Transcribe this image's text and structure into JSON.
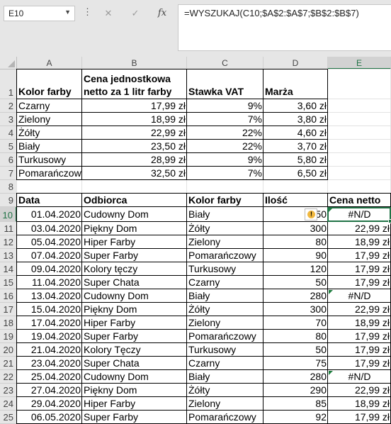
{
  "formula_bar": {
    "name_box": "E10",
    "cancel_icon": "✕",
    "enter_icon": "✓",
    "fx_label": "fx",
    "formula": "=WYSZUKAJ(C10;$A$2:$A$7;$B$2:$B$7)"
  },
  "columns": [
    "A",
    "B",
    "C",
    "D",
    "E"
  ],
  "active_column": "E",
  "active_row": "10",
  "rows": [
    "1",
    "2",
    "3",
    "4",
    "5",
    "6",
    "7",
    "8",
    "9",
    "10",
    "11",
    "12",
    "13",
    "14",
    "15",
    "16",
    "17",
    "18",
    "19",
    "20",
    "21",
    "22",
    "23",
    "24",
    "25"
  ],
  "price_table": {
    "headers": {
      "a": "Kolor farby",
      "b1": "Cena jednostkowa",
      "b2": "netto za 1 litr farby",
      "c": "Stawka VAT",
      "d": "Marża"
    },
    "rows": [
      [
        "Czarny",
        "17,99 zł",
        "9%",
        "3,60 zł"
      ],
      [
        "Zielony",
        "18,99 zł",
        "7%",
        "3,80 zł"
      ],
      [
        "Żółty",
        "22,99 zł",
        "22%",
        "4,60 zł"
      ],
      [
        "Biały",
        "23,50 zł",
        "22%",
        "3,70 zł"
      ],
      [
        "Turkusowy",
        "28,99 zł",
        "9%",
        "5,80 zł"
      ],
      [
        "Pomarańczowy",
        "32,50 zł",
        "7%",
        "6,50 zł"
      ]
    ]
  },
  "orders_table": {
    "headers": [
      "Data",
      "Odbiorca",
      "Kolor farby",
      "Ilość",
      "Cena netto"
    ],
    "rows": [
      [
        "01.04.2020",
        "Cudowny Dom",
        "Biały",
        "50",
        "#N/D"
      ],
      [
        "03.04.2020",
        "Piękny Dom",
        "Żółty",
        "300",
        "22,99 zł"
      ],
      [
        "05.04.2020",
        "Hiper Farby",
        "Zielony",
        "80",
        "18,99 zł"
      ],
      [
        "07.04.2020",
        "Super Farby",
        "Pomarańczowy",
        "90",
        "17,99 zł"
      ],
      [
        "09.04.2020",
        "Kolory tęczy",
        "Turkusowy",
        "120",
        "17,99 zł"
      ],
      [
        "11.04.2020",
        "Super Chata",
        "Czarny",
        "50",
        "17,99 zł"
      ],
      [
        "13.04.2020",
        "Cudowny Dom",
        "Biały",
        "280",
        "#N/D"
      ],
      [
        "15.04.2020",
        "Piękny Dom",
        "Żółty",
        "300",
        "22,99 zł"
      ],
      [
        "17.04.2020",
        "Hiper Farby",
        "Zielony",
        "70",
        "18,99 zł"
      ],
      [
        "19.04.2020",
        "Super Farby",
        "Pomarańczowy",
        "80",
        "17,99 zł"
      ],
      [
        "21.04.2020",
        "Kolory Tęczy",
        "Turkusowy",
        "50",
        "17,99 zł"
      ],
      [
        "23.04.2020",
        "Super Chata",
        "Czarny",
        "75",
        "17,99 zł"
      ],
      [
        "25.04.2020",
        "Cudowny Dom",
        "Biały",
        "280",
        "#N/D"
      ],
      [
        "27.04.2020",
        "Piękny Dom",
        "Żółty",
        "290",
        "22,99 zł"
      ],
      [
        "29.04.2020",
        "Hiper Farby",
        "Zielony",
        "85",
        "18,99 zł"
      ],
      [
        "06.05.2020",
        "Super Farby",
        "Pomarańczowy",
        "92",
        "17,99 zł"
      ]
    ]
  },
  "colors": {
    "excel_green": "#217346",
    "warning": "#f0b840"
  },
  "icons": {
    "name_box_dropdown": "chevron-down-icon",
    "options": "vertical-dots-icon",
    "cancel": "close-icon",
    "enter": "check-icon",
    "function": "fx-icon",
    "error_warning": "warning-icon"
  }
}
